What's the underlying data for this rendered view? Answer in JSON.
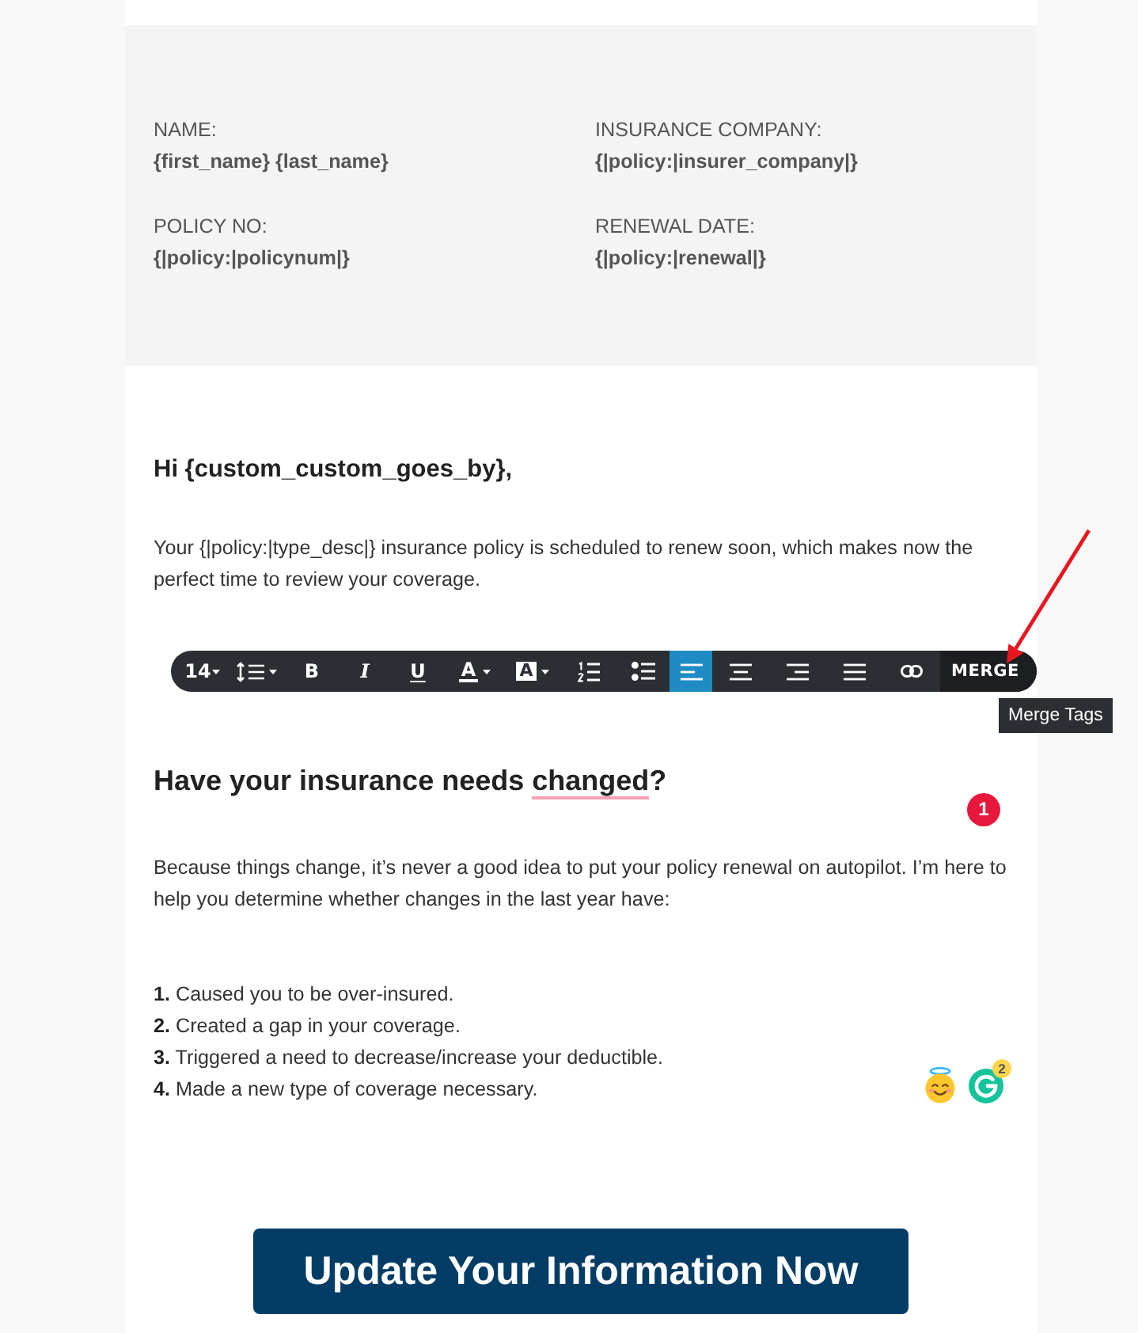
{
  "details_card": {
    "fields": [
      {
        "label": "NAME:",
        "value": "{first_name} {last_name}"
      },
      {
        "label": "INSURANCE COMPANY:",
        "value": "{|policy:|insurer_company|}"
      },
      {
        "label": "POLICY NO:",
        "value": "{|policy:|policynum|}"
      },
      {
        "label": "RENEWAL DATE:",
        "value": "{|policy:|renewal|}"
      }
    ]
  },
  "greeting": "Hi {custom_custom_goes_by},",
  "intro": "Your {|policy:|type_desc|} insurance policy is scheduled to renew soon, which makes now the perfect time to review your coverage.",
  "toolbar": {
    "items": [
      {
        "kind": "font_size",
        "label": "14",
        "selected": false,
        "hovered": false
      },
      {
        "kind": "line_height",
        "selected": false,
        "hovered": false
      },
      {
        "kind": "bold",
        "label": "B",
        "selected": false,
        "hovered": false
      },
      {
        "kind": "italic",
        "label": "I",
        "selected": false,
        "hovered": false
      },
      {
        "kind": "underline",
        "label": "U",
        "selected": false,
        "hovered": false
      },
      {
        "kind": "text_color",
        "label": "A",
        "selected": false,
        "hovered": false
      },
      {
        "kind": "highlight",
        "label": "A",
        "selected": false,
        "hovered": false
      },
      {
        "kind": "ordered_list",
        "selected": false,
        "hovered": false
      },
      {
        "kind": "bullet_list",
        "selected": false,
        "hovered": false
      },
      {
        "kind": "align_left",
        "selected": true,
        "hovered": false
      },
      {
        "kind": "align_center",
        "selected": false,
        "hovered": false
      },
      {
        "kind": "align_right",
        "selected": false,
        "hovered": false
      },
      {
        "kind": "justify",
        "selected": false,
        "hovered": false
      },
      {
        "kind": "link",
        "selected": false,
        "hovered": false
      },
      {
        "kind": "merge",
        "label": "MERGE",
        "selected": false,
        "hovered": true
      }
    ],
    "tooltip": "Merge Tags"
  },
  "heading": {
    "parts": [
      {
        "text": "Have your insurance needs ",
        "flagged": false
      },
      {
        "text": "changed",
        "flagged": true
      },
      {
        "text": "?",
        "flagged": false
      }
    ]
  },
  "alert_badge": "1",
  "body": "Because things change, it’s never a good idea to put your policy renewal on autopilot. I’m here to help you determine whether changes in the last year have:",
  "list": [
    "**1.** Caused you to be over-insured.",
    "**2.** Created a gap in your coverage.",
    "**3.** Triggered a need to decrease/increase your deductible.",
    "**4.** Made a new type of coverage necessary."
  ],
  "assistant_badge": "2",
  "cta": "Update Your Information Now"
}
